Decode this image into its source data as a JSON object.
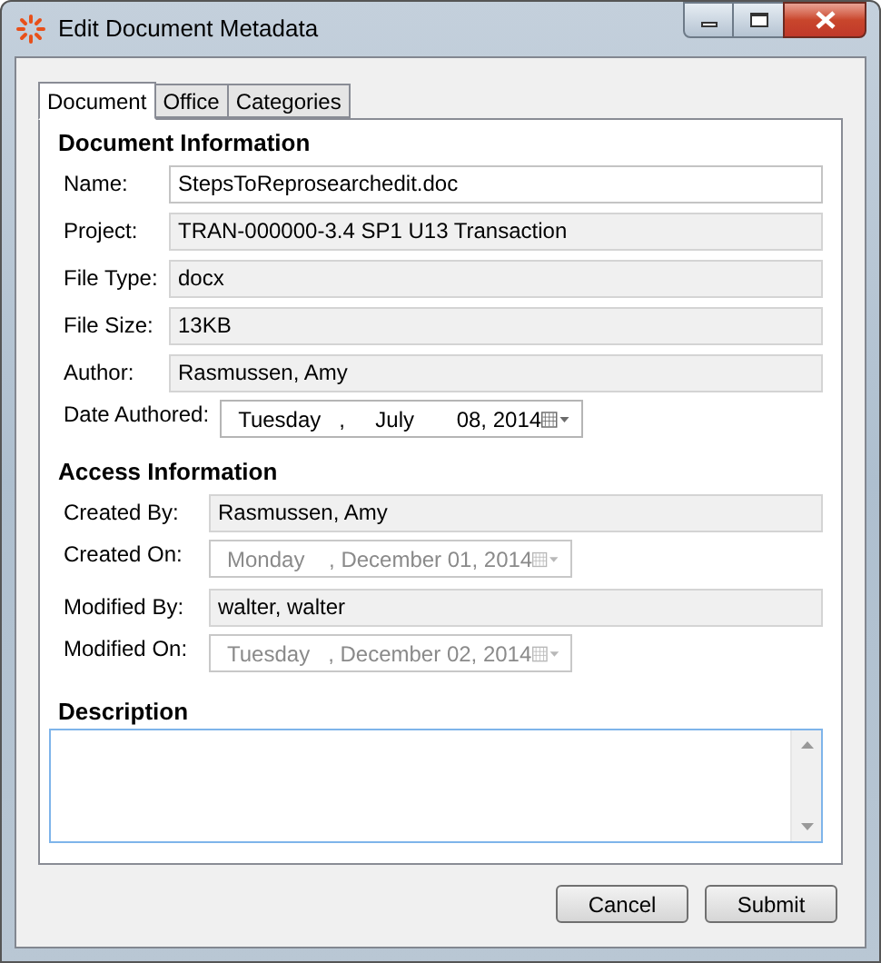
{
  "window": {
    "title": "Edit Document Metadata"
  },
  "tabs": [
    {
      "label": "Document",
      "selected": true
    },
    {
      "label": "Office",
      "selected": false
    },
    {
      "label": "Categories",
      "selected": false
    }
  ],
  "sections": [
    {
      "title": "Document Information",
      "fields": [
        {
          "kind": "text",
          "label": "Name:",
          "value": "StepsToReprosearchedit.doc",
          "readonly": false
        },
        {
          "kind": "text",
          "label": "Project:",
          "value": "TRAN-000000-3.4 SP1 U13 Transaction",
          "readonly": true
        },
        {
          "kind": "text",
          "label": "File Type:",
          "value": "docx",
          "readonly": true
        },
        {
          "kind": "text",
          "label": "File Size:",
          "value": "13KB",
          "readonly": true
        },
        {
          "kind": "text",
          "label": "Author:",
          "value": "Rasmussen, Amy",
          "readonly": true
        },
        {
          "kind": "date",
          "label": "Date Authored:",
          "value": "Tuesday   ,     July       08, 2014",
          "disabled": false
        }
      ]
    },
    {
      "title": "Access Information",
      "fields": [
        {
          "kind": "text",
          "label": "Created By:",
          "value": "Rasmussen, Amy",
          "readonly": true
        },
        {
          "kind": "date",
          "label": "Created On:",
          "value": "Monday    , December 01, 2014",
          "disabled": true
        },
        {
          "kind": "text",
          "label": "Modified By:",
          "value": "walter, walter",
          "readonly": true
        },
        {
          "kind": "date",
          "label": "Modified On:",
          "value": "Tuesday   , December 02, 2014",
          "disabled": true
        }
      ]
    }
  ],
  "description": {
    "title": "Description"
  },
  "buttons": [
    "Cancel",
    "Submit"
  ]
}
